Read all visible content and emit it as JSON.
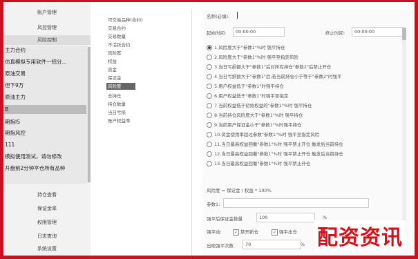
{
  "nav_top": [
    "账户管理",
    "风控管理",
    "风险控制"
  ],
  "list": [
    "主力合约",
    "仿真模拟专用软件一招分...",
    "原油交易",
    "但下9万",
    "原油主力",
    "B",
    "期指IS",
    "期指风控",
    "111",
    "模拟使用测试，请勿修改",
    "开盘前2分钟平仓所有品种"
  ],
  "selected_index": 5,
  "nav_bottom": [
    "持仓查看",
    "保证金率",
    "权限管理",
    "日志查询",
    "系统设置"
  ],
  "tree": [
    "可交易品种(合约)",
    "交易合约",
    "交易数量",
    "不活跃合约",
    "风险度",
    "权益",
    "资金",
    "保证金",
    "风险度",
    "总持仓",
    "持仓数量",
    "当日亏损",
    "账户权益率"
  ],
  "tree_selected_index": 8,
  "form": {
    "name_label": "名称(必填):",
    "start_time_label": "起始时间:",
    "start_time_value": "00:00:00",
    "end_time_label": "终止时间:",
    "end_time_value": "00:00:00",
    "radios": [
      "1.风险度大于\"参数1\"%时 强平持仓",
      "2.风险度大于\"参数1\"%时 强平至指定风险",
      "3.当日亏损额大于\"参数1\"后对所有持仓\"参数2\"后禁止开仓",
      "4.当日亏损额大于\"参数1\"后,若当前持仓小于等于\"参数2\"时强平",
      "5.用户权益低于\"参数1\"时强平持仓",
      "6.用户权益低于\"参数1\"时强平至指定",
      "7.当前权益低于初始权益的\"参数1\"%时 强平持仓",
      "8.当前持仓风险度大于\"参数1\"%时 强平持仓",
      "9.当前用户保证金小于\"参数1\"%时强平持仓",
      "10.资金使用率超过参数\"参数1\"%时 强平至指定风险",
      "11.当日最高权益回撤\"参数1\"%时 强平禁止开仓 触发后当前持仓",
      "12.当日最高权益回撤\"参数1\"%时 强平禁止开仓 触发后当前持仓",
      "13.当日最高权益回撤\"参数1\"%时 强平禁止开仓"
    ],
    "selected_radio": 0,
    "formula": "风险度 = 保证金 / 权益 * 100%",
    "param1_label": "参数1:",
    "param1_value": "",
    "force_label": "强平后保证金数量",
    "force_value": "100",
    "percent": "%",
    "action_label": "强平动:",
    "check1": "禁开新仓",
    "check2": "强平出仓",
    "ratio_label": "出现强平次数",
    "ratio_value": "70"
  },
  "watermark": "配资资讯"
}
